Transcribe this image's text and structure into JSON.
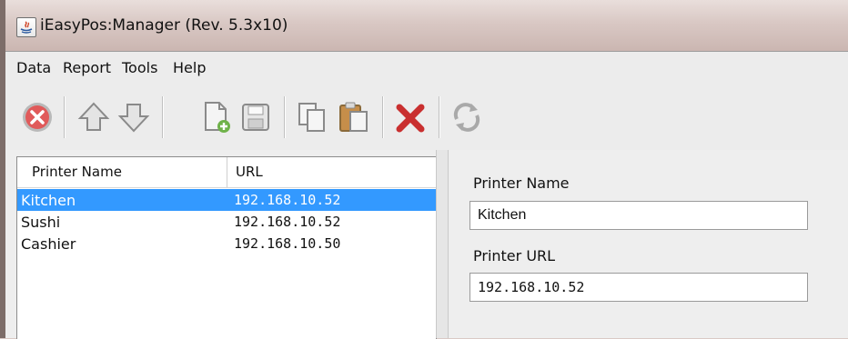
{
  "window": {
    "title": "iEasyPos:Manager (Rev. 5.3x10)"
  },
  "menu": [
    "Data",
    "Report",
    "Tools",
    "Help"
  ],
  "toolbar": {
    "buttons": [
      {
        "name": "cancel-icon"
      },
      {
        "name": "move-up-icon"
      },
      {
        "name": "move-down-icon"
      },
      {
        "name": "new-document-icon"
      },
      {
        "name": "save-icon"
      },
      {
        "name": "copy-icon"
      },
      {
        "name": "paste-icon"
      },
      {
        "name": "delete-icon"
      },
      {
        "name": "refresh-icon"
      }
    ]
  },
  "table": {
    "columns": [
      "Printer Name",
      "URL"
    ],
    "rows": [
      {
        "name": "Kitchen",
        "url": "192.168.10.52",
        "selected": true
      },
      {
        "name": "Sushi",
        "url": "192.168.10.52",
        "selected": false
      },
      {
        "name": "Cashier",
        "url": "192.168.10.50",
        "selected": false
      }
    ]
  },
  "form": {
    "printer_name_label": "Printer Name",
    "printer_name_value": "Kitchen",
    "printer_url_label": "Printer URL",
    "printer_url_value": "192.168.10.52"
  },
  "colors": {
    "selection": "#3399ff",
    "titlebar": "#d9c8c4"
  }
}
